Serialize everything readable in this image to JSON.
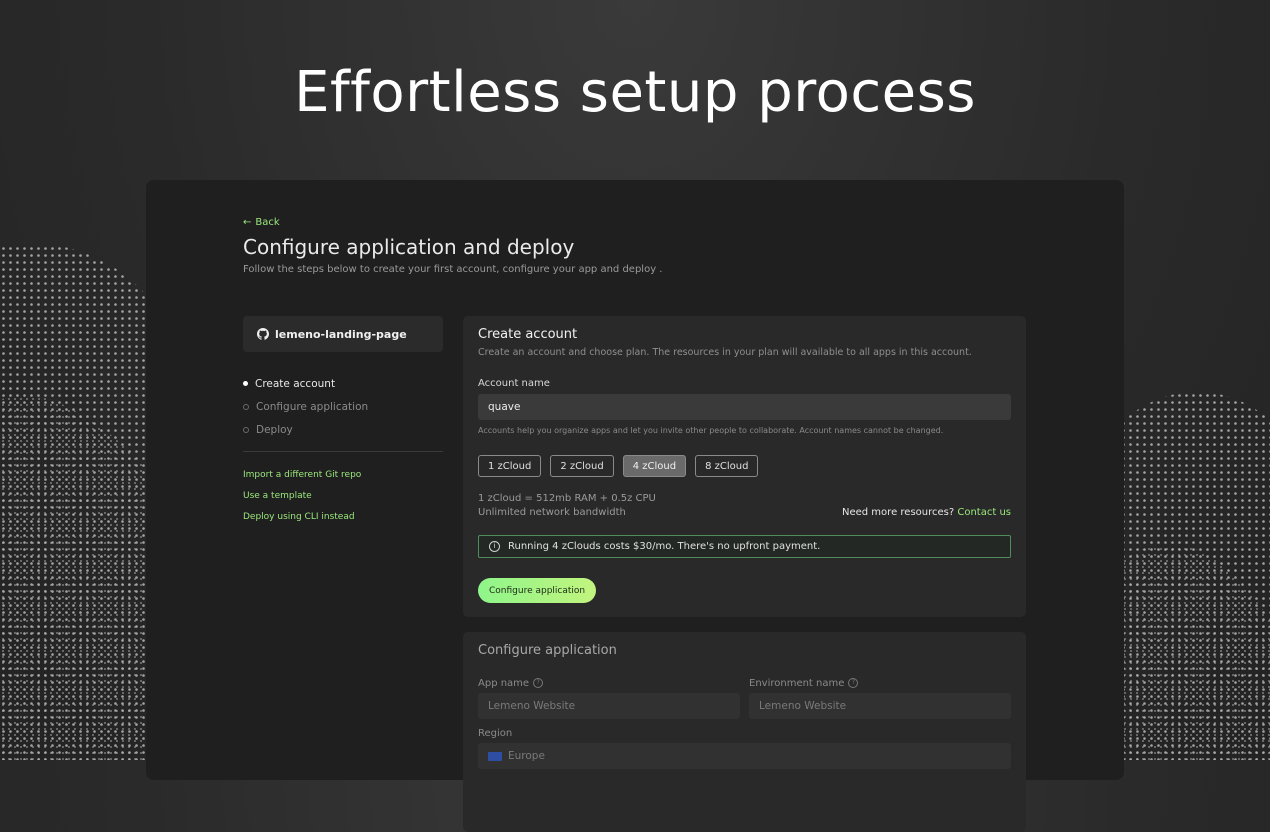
{
  "hero": {
    "title": "Effortless setup process"
  },
  "header": {
    "back_label": "Back",
    "title": "Configure application and deploy",
    "subtitle": "Follow the steps below to create your first account, configure your app and deploy ."
  },
  "sidebar": {
    "repo_name": "lemeno-landing-page",
    "steps": [
      {
        "label": "Create account",
        "active": true
      },
      {
        "label": "Configure application",
        "active": false
      },
      {
        "label": "Deploy",
        "active": false
      }
    ],
    "links": [
      {
        "label": "Import a different Git repo"
      },
      {
        "label": "Use a template"
      },
      {
        "label": "Deploy using CLI instead"
      }
    ]
  },
  "create_account": {
    "title": "Create account",
    "subtitle": "Create an account and choose plan. The resources in your plan will available to all apps in this account.",
    "account_name_label": "Account name",
    "account_name_value": "quave",
    "hint": "Accounts help you organize apps and let you invite other people to collaborate. Account names cannot be changed.",
    "plans": [
      {
        "label": "1 zCloud",
        "selected": false
      },
      {
        "label": "2 zCloud",
        "selected": false
      },
      {
        "label": "4 zCloud",
        "selected": true
      },
      {
        "label": "8 zCloud",
        "selected": false
      }
    ],
    "spec_line1": "1 zCloud = 512mb RAM + 0.5z CPU",
    "spec_line2": "Unlimited network bandwidth",
    "more_resources_text": "Need more resources?",
    "contact_link": "Contact us",
    "notice": "Running 4 zClouds costs $30/mo. There's no upfront payment.",
    "cta_label": "Configure application"
  },
  "configure_application": {
    "title": "Configure application",
    "app_name_label": "App name",
    "app_name_value": "Lemeno Website",
    "env_name_label": "Environment name",
    "env_name_value": "Lemeno Website",
    "region_label": "Region",
    "region_value": "Europe"
  },
  "colors": {
    "accent": "#9be87c",
    "background": "#2a2a2a",
    "panel": "#29292a"
  }
}
